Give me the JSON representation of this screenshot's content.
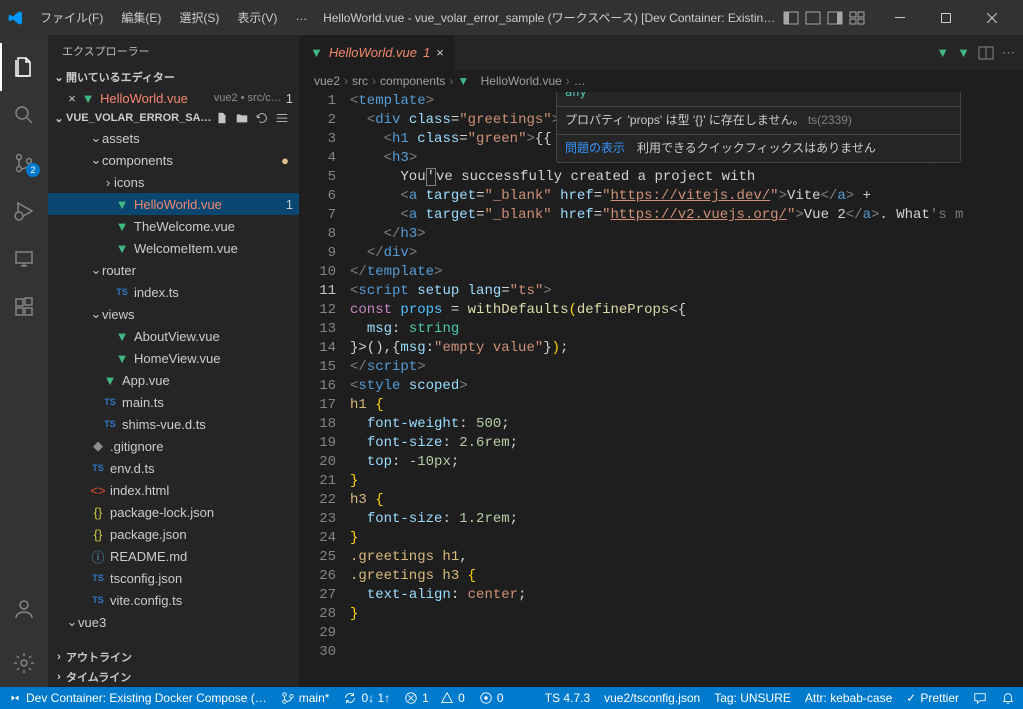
{
  "title_bar": {
    "menus": [
      "ファイル(F)",
      "編集(E)",
      "選択(S)",
      "表示(V)",
      "…"
    ],
    "title": "HelloWorld.vue - vue_volar_error_sample (ワークスペース) [Dev Container: Existin…"
  },
  "activity": {
    "badge_scm": "2"
  },
  "sidebar": {
    "title": "エクスプローラー",
    "open_editors": "開いているエディター",
    "open_item": {
      "name": "HelloWorld.vue",
      "hint": "vue2 • src/c…",
      "badge": "1"
    },
    "workspace": "VUE_VOLAR_ERROR_SA…",
    "tree": [
      {
        "d": 2,
        "t": "folder-open",
        "l": "assets"
      },
      {
        "d": 2,
        "t": "folder-open",
        "l": "components",
        "dot": true
      },
      {
        "d": 3,
        "t": "folder",
        "l": "icons"
      },
      {
        "d": 3,
        "t": "vue",
        "l": "HelloWorld.vue",
        "sel": true,
        "badge": "1",
        "err": true
      },
      {
        "d": 3,
        "t": "vue",
        "l": "TheWelcome.vue"
      },
      {
        "d": 3,
        "t": "vue",
        "l": "WelcomeItem.vue"
      },
      {
        "d": 2,
        "t": "folder-open",
        "l": "router"
      },
      {
        "d": 3,
        "t": "ts",
        "l": "index.ts"
      },
      {
        "d": 2,
        "t": "folder-open",
        "l": "views"
      },
      {
        "d": 3,
        "t": "vue",
        "l": "AboutView.vue"
      },
      {
        "d": 3,
        "t": "vue",
        "l": "HomeView.vue"
      },
      {
        "d": 2,
        "t": "vue",
        "l": "App.vue"
      },
      {
        "d": 2,
        "t": "ts",
        "l": "main.ts"
      },
      {
        "d": 2,
        "t": "ts",
        "l": "shims-vue.d.ts"
      },
      {
        "d": 1,
        "t": "git",
        "l": ".gitignore"
      },
      {
        "d": 1,
        "t": "ts",
        "l": "env.d.ts"
      },
      {
        "d": 1,
        "t": "html",
        "l": "index.html"
      },
      {
        "d": 1,
        "t": "json",
        "l": "package-lock.json"
      },
      {
        "d": 1,
        "t": "json",
        "l": "package.json"
      },
      {
        "d": 1,
        "t": "md",
        "l": "README.md"
      },
      {
        "d": 1,
        "t": "ts",
        "l": "tsconfig.json"
      },
      {
        "d": 1,
        "t": "ts",
        "l": "vite.config.ts"
      },
      {
        "d": 0,
        "t": "folder-open",
        "l": "vue3"
      }
    ],
    "outline": "アウトライン",
    "timeline": "タイムライン"
  },
  "tab": {
    "name": "HelloWorld.vue",
    "badge": "1"
  },
  "breadcrumbs": [
    "vue2",
    "src",
    "components",
    "HelloWorld.vue",
    "…"
  ],
  "hover": {
    "type": "any",
    "msg_pre": "プロパティ 'props' は型 '{}' に存在しません。",
    "code": "ts(2339)",
    "link": "問題の表示",
    "quickfix": "利用できるクイックフィックスはありません"
  },
  "code": {
    "link1": "https://vitejs.dev/",
    "link1_text": "Vite",
    "link2": "https://v2.vuejs.org/",
    "link2_text": "Vue 2"
  },
  "status": {
    "remote": "Dev Container: Existing Docker Compose (…",
    "branch": "main*",
    "sync": "0↓ 1↑",
    "err": "1",
    "warn": "0",
    "ports": "0",
    "ts": "TS 4.7.3",
    "tsconfig": "vue2/tsconfig.json",
    "tag": "Tag: UNSURE",
    "attr": "Attr: kebab-case",
    "prettier": "Prettier"
  }
}
